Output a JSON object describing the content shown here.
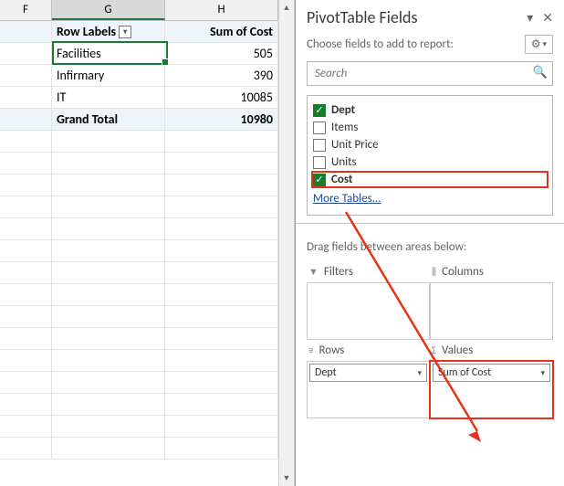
{
  "sheet": {
    "cols": [
      "F",
      "G",
      "H"
    ],
    "header": {
      "row_labels": "Row Labels",
      "sum_of_cost": "Sum of Cost"
    },
    "rows": [
      {
        "label": "Facilities",
        "value": "505"
      },
      {
        "label": "Infirmary",
        "value": "390"
      },
      {
        "label": "IT",
        "value": "10085"
      }
    ],
    "grand_total": {
      "label": "Grand Total",
      "value": "10980"
    }
  },
  "pane": {
    "title": "PivotTable Fields",
    "subhead": "Choose fields to add to report:",
    "search_placeholder": "Search",
    "fields": [
      {
        "name": "Dept",
        "checked": true,
        "bold": true,
        "highlight": false
      },
      {
        "name": "Items",
        "checked": false,
        "bold": false,
        "highlight": false
      },
      {
        "name": "Unit Price",
        "checked": false,
        "bold": false,
        "highlight": false
      },
      {
        "name": "Units",
        "checked": false,
        "bold": false,
        "highlight": false
      },
      {
        "name": "Cost",
        "checked": true,
        "bold": true,
        "highlight": true
      }
    ],
    "more_tables": "More Tables...",
    "drag_label": "Drag fields between areas below:",
    "areas": {
      "filters": {
        "label": "Filters"
      },
      "columns": {
        "label": "Columns"
      },
      "rows": {
        "label": "Rows",
        "chip": "Dept"
      },
      "values": {
        "label": "Values",
        "chip": "Sum of Cost"
      }
    }
  },
  "chart_data": {
    "type": "table",
    "title": "Sum of Cost by Dept",
    "columns": [
      "Row Labels",
      "Sum of Cost"
    ],
    "rows": [
      [
        "Facilities",
        505
      ],
      [
        "Infirmary",
        390
      ],
      [
        "IT",
        10085
      ]
    ],
    "grand_total": [
      "Grand Total",
      10980
    ]
  }
}
